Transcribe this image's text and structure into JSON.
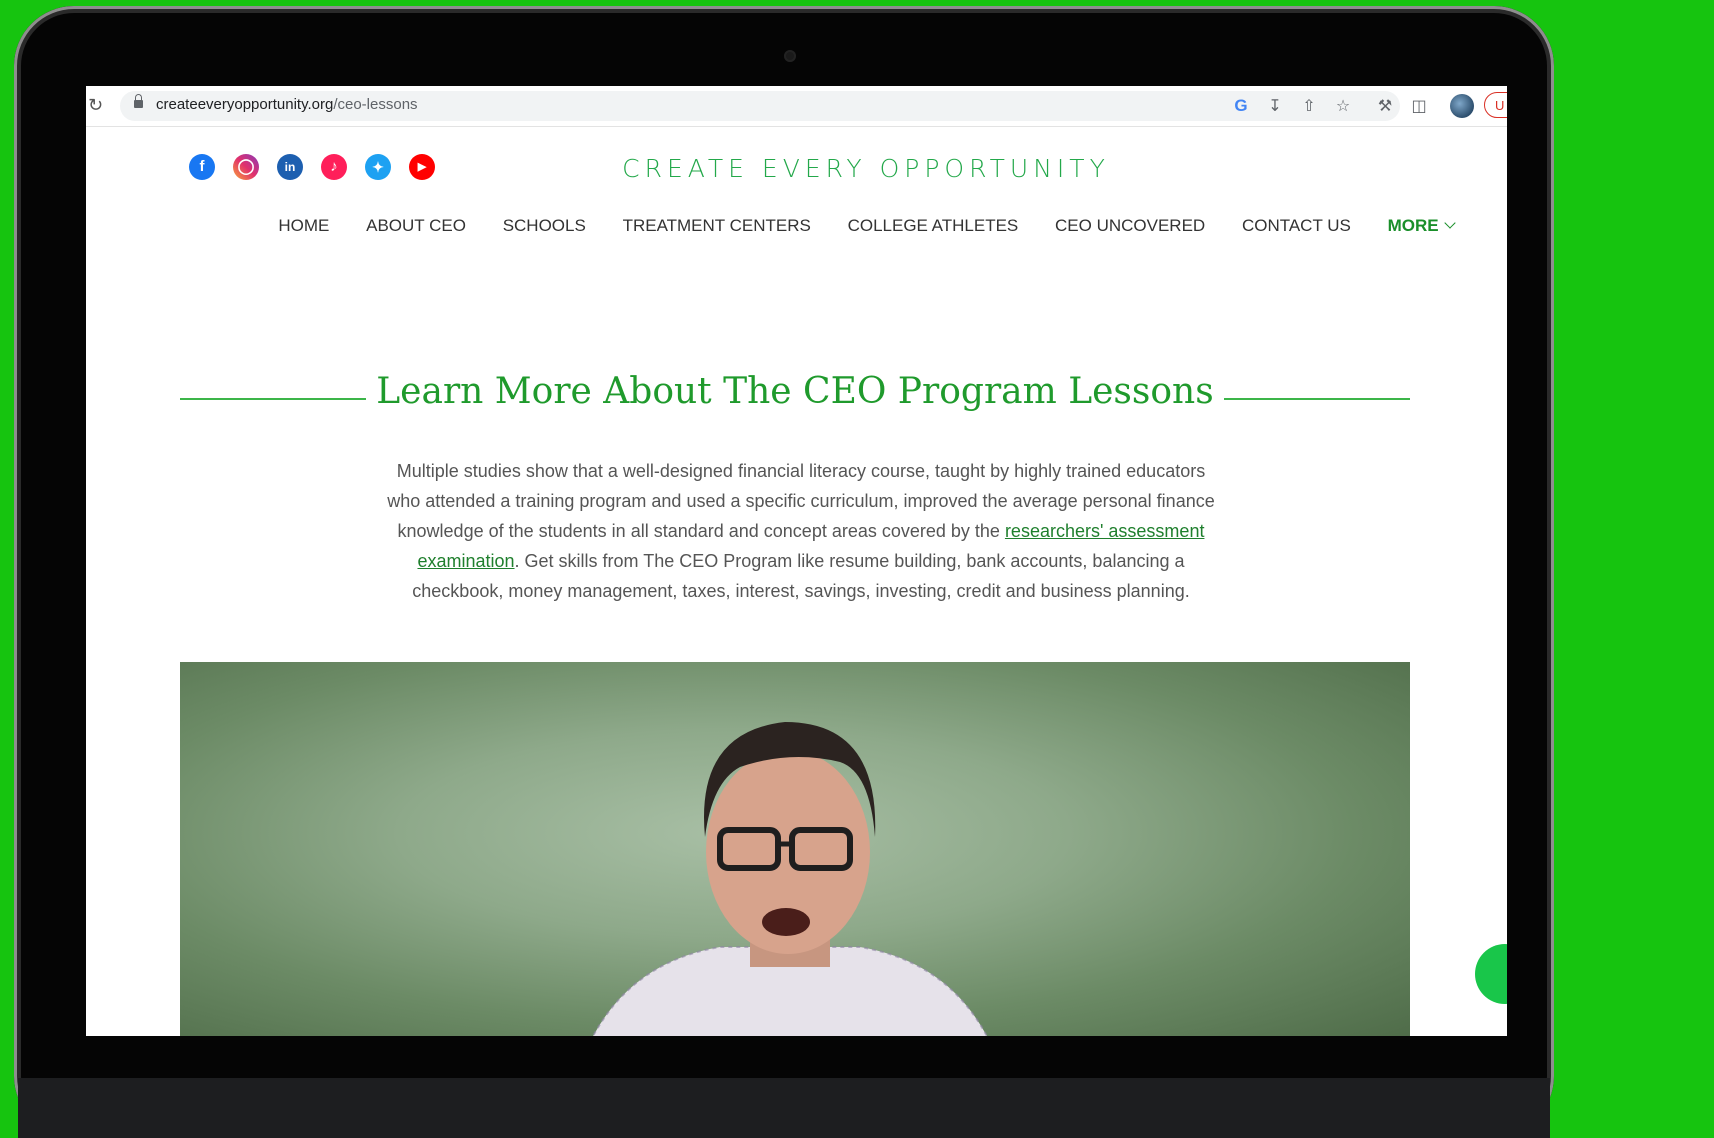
{
  "browser": {
    "url_domain": "createeveryopportunity.org",
    "url_path": "/ceo-lessons",
    "update_label": "U"
  },
  "site": {
    "title": "CREATE EVERY OPPORTUNITY",
    "social": [
      "facebook-icon",
      "instagram-icon",
      "linkedin-icon",
      "tiktok-icon",
      "twitter-icon",
      "youtube-icon"
    ],
    "nav": {
      "home": "HOME",
      "about": "ABOUT CEO",
      "schools": "SCHOOLS",
      "treatment": "TREATMENT CENTERS",
      "athletes": "COLLEGE ATHLETES",
      "uncovered": "CEO UNCOVERED",
      "contact": "CONTACT US",
      "more": "MORE"
    }
  },
  "section": {
    "heading": "Learn More About The CEO Program Lessons",
    "intro_before": "Multiple studies show that a well-designed financial literacy course, taught by highly trained educators who attended a training program and used a specific curriculum, improved the average personal finance knowledge of the students in all standard and concept areas covered by the ",
    "intro_link": "researchers' assessment examination",
    "intro_after": ". Get skills from The CEO Program like resume building, bank accounts, balancing a checkbook, money management, taxes, interest, savings, investing, credit and business planning."
  },
  "colors": {
    "background": "#16c40f",
    "brand_green": "#23a84a",
    "nav_more": "#1a8f2a"
  }
}
